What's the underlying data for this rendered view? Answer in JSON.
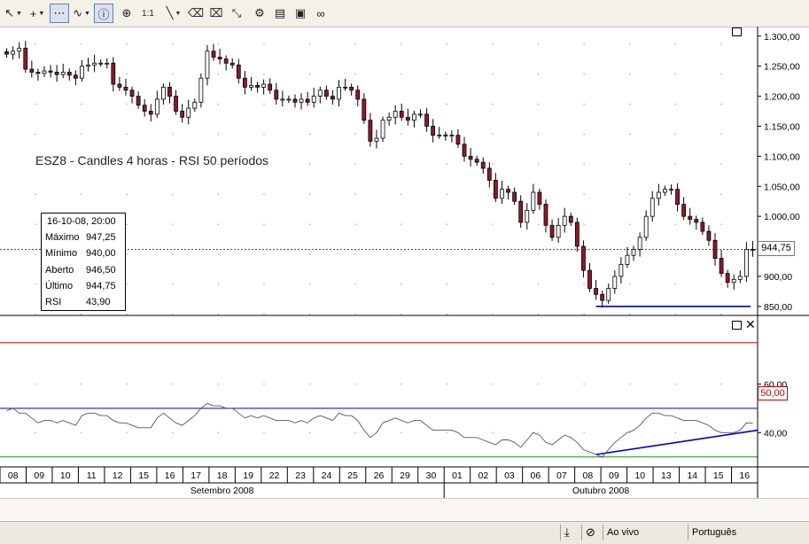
{
  "toolbar": {
    "tools": [
      {
        "name": "cursor-tool-button",
        "glyph": "↖",
        "dropdown": true,
        "selected": false
      },
      {
        "name": "crosshair-tool-button",
        "glyph": "+",
        "dropdown": true,
        "selected": false
      },
      {
        "name": "grid-tool-button",
        "glyph": "⋯",
        "dropdown": false,
        "selected": true
      },
      {
        "name": "indicator-tool-button",
        "glyph": "∿",
        "dropdown": true,
        "selected": false
      },
      {
        "name": "info-tool-button",
        "glyph": "ⓘ",
        "dropdown": false,
        "selected": true
      },
      {
        "name": "zoom-tool-button",
        "glyph": "⊕",
        "dropdown": false,
        "selected": false
      },
      {
        "name": "zoom-reset-button",
        "glyph": "1:1",
        "dropdown": false,
        "selected": false
      },
      {
        "name": "line-tool-button",
        "glyph": "╲",
        "dropdown": true,
        "selected": false
      },
      {
        "name": "eraser-tool-button",
        "glyph": "⌫",
        "dropdown": false,
        "selected": false
      },
      {
        "name": "eraser-all-button",
        "glyph": "⌧",
        "dropdown": false,
        "selected": false
      },
      {
        "name": "arrows-tool-button",
        "glyph": "⤡",
        "dropdown": false,
        "selected": false
      },
      {
        "name": "objects-tool-button",
        "glyph": "⚙",
        "dropdown": false,
        "selected": false
      },
      {
        "name": "template-tool-button",
        "glyph": "▤",
        "dropdown": false,
        "selected": false
      },
      {
        "name": "image-tool-button",
        "glyph": "▣",
        "dropdown": false,
        "selected": false
      },
      {
        "name": "link-tool-button",
        "glyph": "∞",
        "dropdown": false,
        "selected": false
      }
    ]
  },
  "chart_title": "ESZ8 - Candles 4 horas - RSI 50 períodos",
  "infobox": {
    "date": "16-10-08, 20:00",
    "rows": [
      {
        "label": "Máximo",
        "value": "947,25"
      },
      {
        "label": "Mínimo",
        "value": "940,00"
      },
      {
        "label": "Aberto",
        "value": "946,50"
      },
      {
        "label": "Último",
        "value": "944,75"
      },
      {
        "label": "RSI",
        "value": "43,90"
      }
    ]
  },
  "price_badge": "944,75",
  "rsi_badge": "50,00",
  "statusbar": {
    "mode": "Ao vivo",
    "language": "Português"
  },
  "colors": {
    "up_candle": "#ffffff",
    "down_candle": "#8b1a2b",
    "rsi_line": "#555555",
    "level_line": "#0000cc",
    "last_price_line": "#cc0000"
  },
  "chart_data": [
    {
      "type": "candlestick",
      "ylim": [
        835,
        1310
      ],
      "yticks": [
        850,
        900,
        950,
        1000,
        1050,
        1100,
        1150,
        1200,
        1250,
        1300
      ],
      "ytick_labels": [
        "850,00",
        "900,00",
        "950,00",
        "1.000,00",
        "1.050,00",
        "1.100,00",
        "1.150,00",
        "1.200,00",
        "1.250,00",
        "1.300,00"
      ],
      "x_labels": [
        "08",
        "09",
        "10",
        "11",
        "12",
        "15",
        "16",
        "17",
        "18",
        "19",
        "22",
        "23",
        "24",
        "25",
        "26",
        "29",
        "30",
        "01",
        "02",
        "03",
        "06",
        "07",
        "08",
        "09",
        "10",
        "13",
        "14",
        "15",
        "16"
      ],
      "months": [
        "Setembro 2008",
        "Outubro 2008"
      ],
      "closes": [
        1270,
        1275,
        1280,
        1245,
        1240,
        1238,
        1242,
        1240,
        1236,
        1240,
        1235,
        1230,
        1250,
        1252,
        1255,
        1255,
        1255,
        1220,
        1215,
        1210,
        1200,
        1185,
        1175,
        1170,
        1195,
        1215,
        1200,
        1175,
        1165,
        1180,
        1190,
        1230,
        1275,
        1265,
        1262,
        1255,
        1252,
        1230,
        1215,
        1218,
        1215,
        1220,
        1210,
        1195,
        1195,
        1195,
        1190,
        1195,
        1190,
        1200,
        1210,
        1200,
        1195,
        1215,
        1215,
        1210,
        1195,
        1160,
        1125,
        1130,
        1160,
        1165,
        1175,
        1165,
        1160,
        1170,
        1170,
        1150,
        1135,
        1135,
        1135,
        1135,
        1120,
        1100,
        1095,
        1090,
        1080,
        1060,
        1030,
        1045,
        1040,
        1025,
        990,
        1010,
        1040,
        1020,
        985,
        965,
        985,
        1000,
        990,
        950,
        910,
        880,
        870,
        860,
        880,
        900,
        920,
        935,
        945,
        965,
        1000,
        1030,
        1040,
        1045,
        1045,
        1020,
        1000,
        995,
        990,
        975,
        960,
        930,
        905,
        890,
        895,
        900,
        945,
        944.75
      ]
    },
    {
      "type": "line",
      "name": "RSI",
      "ylim": [
        27,
        86
      ],
      "yticks": [
        40,
        60
      ],
      "ytick_labels": [
        "40,00",
        "60,00"
      ],
      "reference_lines": [
        50,
        77,
        30
      ],
      "values": [
        49,
        50,
        48,
        48,
        46,
        44,
        45,
        45,
        44,
        45,
        44,
        43,
        47,
        48,
        48,
        47,
        47,
        45,
        44,
        44,
        43,
        42,
        42,
        42,
        46,
        48,
        46,
        44,
        43,
        45,
        47,
        50,
        52,
        51,
        51,
        50,
        50,
        48,
        46,
        47,
        46,
        47,
        46,
        45,
        45,
        45,
        44,
        45,
        44,
        46,
        47,
        46,
        45,
        48,
        47,
        47,
        45,
        41,
        38,
        40,
        44,
        45,
        46,
        45,
        44,
        45,
        45,
        43,
        41,
        41,
        41,
        41,
        40,
        38,
        38,
        38,
        37,
        36,
        35,
        37,
        37,
        36,
        34,
        37,
        40,
        39,
        36,
        35,
        37,
        39,
        38,
        36,
        33,
        32,
        31,
        30,
        33,
        36,
        38,
        40,
        41,
        43,
        46,
        48,
        48,
        47,
        47,
        46,
        45,
        45,
        45,
        44,
        43,
        41,
        40,
        40,
        40,
        41,
        44,
        43.9
      ]
    }
  ]
}
